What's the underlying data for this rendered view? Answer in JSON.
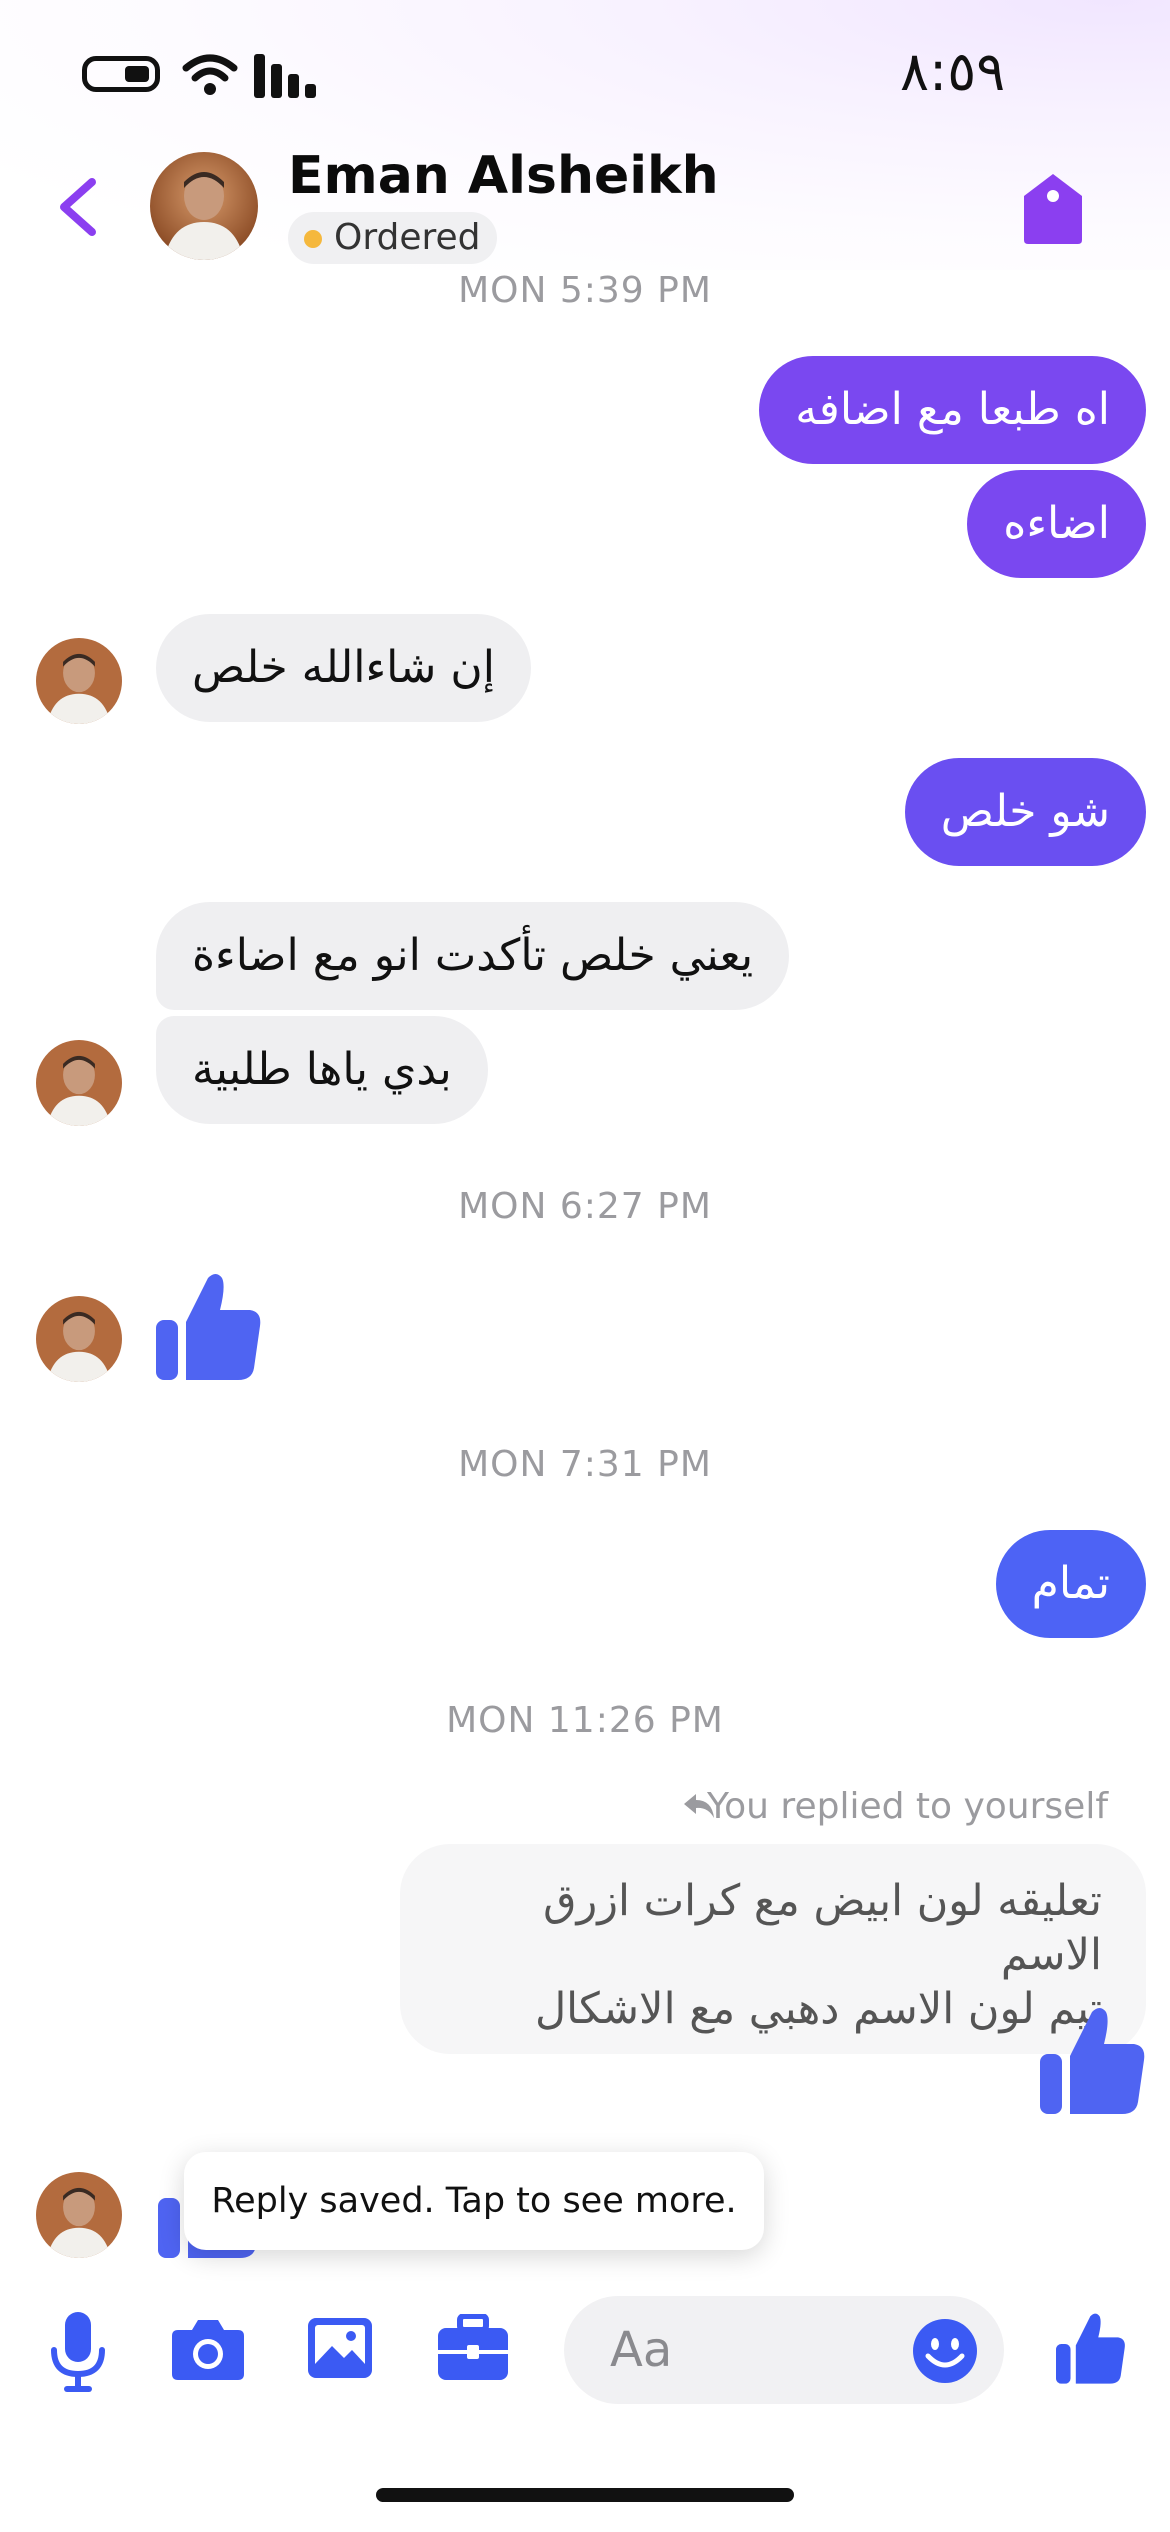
{
  "status_bar": {
    "time": "٨:٥٩"
  },
  "header": {
    "contact_name": "Eman Alsheikh",
    "status": "Ordered",
    "status_color": "#f5b83d"
  },
  "messages": {
    "ts1": "MON 5:39 PM",
    "out1": "اه طبعا مع اضافه",
    "out2": "اضاءه",
    "in1": "إن شاءالله خلص",
    "out3": "شو خلص",
    "in2": "يعني خلص تأكدت انو مع اضاءة",
    "in3": "بدي ياها طلبية",
    "ts2": "MON 6:27 PM",
    "ts3": "MON 7:31 PM",
    "out4": "تمام",
    "ts4": "MON 11:26 PM",
    "reply_label": "You replied to yourself",
    "reply_line1": "تعليقه لون ابيض مع كرات ازرق  الاسم",
    "reply_line2": "تيم لون الاسم دهبي مع الاشكال"
  },
  "toast": {
    "text": "Reply saved. Tap to see more."
  },
  "composer": {
    "placeholder": "Aa",
    "icons": [
      "microphone-icon",
      "camera-icon",
      "gallery-icon",
      "briefcase-icon",
      "emoji-icon",
      "thumbs-up-icon"
    ]
  },
  "colors": {
    "accent_purple": "#8b3ff0",
    "bubble_purple": "#7a48f0",
    "bubble_indigo": "#6457f2",
    "bubble_blue": "#4d63f5",
    "icon_blue": "#3b5af3",
    "like_blue": "#4f64f2"
  }
}
